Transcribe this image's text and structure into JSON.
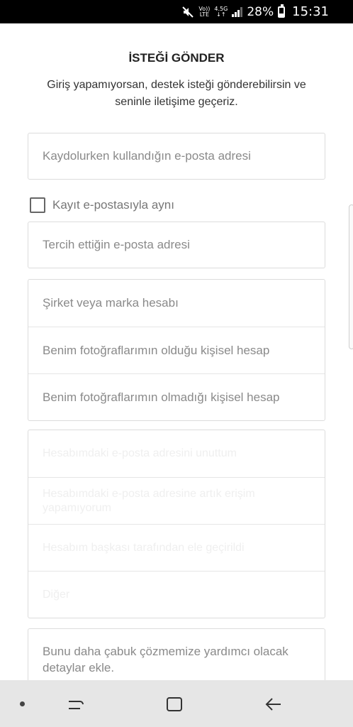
{
  "status_bar": {
    "network_top": "Vo))",
    "network_bottom": "LTE",
    "network2_top": "4.5G",
    "network2_bottom": "↓↑",
    "battery": "28%",
    "time": "15:31"
  },
  "header": {
    "title": "İSTEĞİ GÖNDER",
    "subtitle": "Giriş yapamıyorsan, destek isteği gönderebilirsin ve seninle iletişime geçeriz."
  },
  "form": {
    "email_placeholder": "Kaydolurken kullandığın e-posta adresi",
    "same_checkbox_label": "Kayıt e-postasıyla aynı",
    "pref_email_placeholder": "Tercih ettiğin e-posta adresi",
    "account_types": [
      "Şirket veya marka hesabı",
      "Benim fotoğraflarımın olduğu kişisel hesap",
      "Benim fotoğraflarımın olmadığı kişisel hesap"
    ],
    "issue_options": [
      "Hesabımdaki e-posta adresini unuttum",
      "Hesabımdaki e-posta adresine artık erişim yapamıyorum",
      "Hesabım başkası tarafından ele geçirildi",
      "Diğer"
    ],
    "details_placeholder": "Bunu daha çabuk çözmemize yardımcı olacak detaylar ekle."
  },
  "nav_bar": {
    "icons": [
      "dot-icon",
      "recents-icon",
      "home-icon",
      "back-icon"
    ]
  }
}
